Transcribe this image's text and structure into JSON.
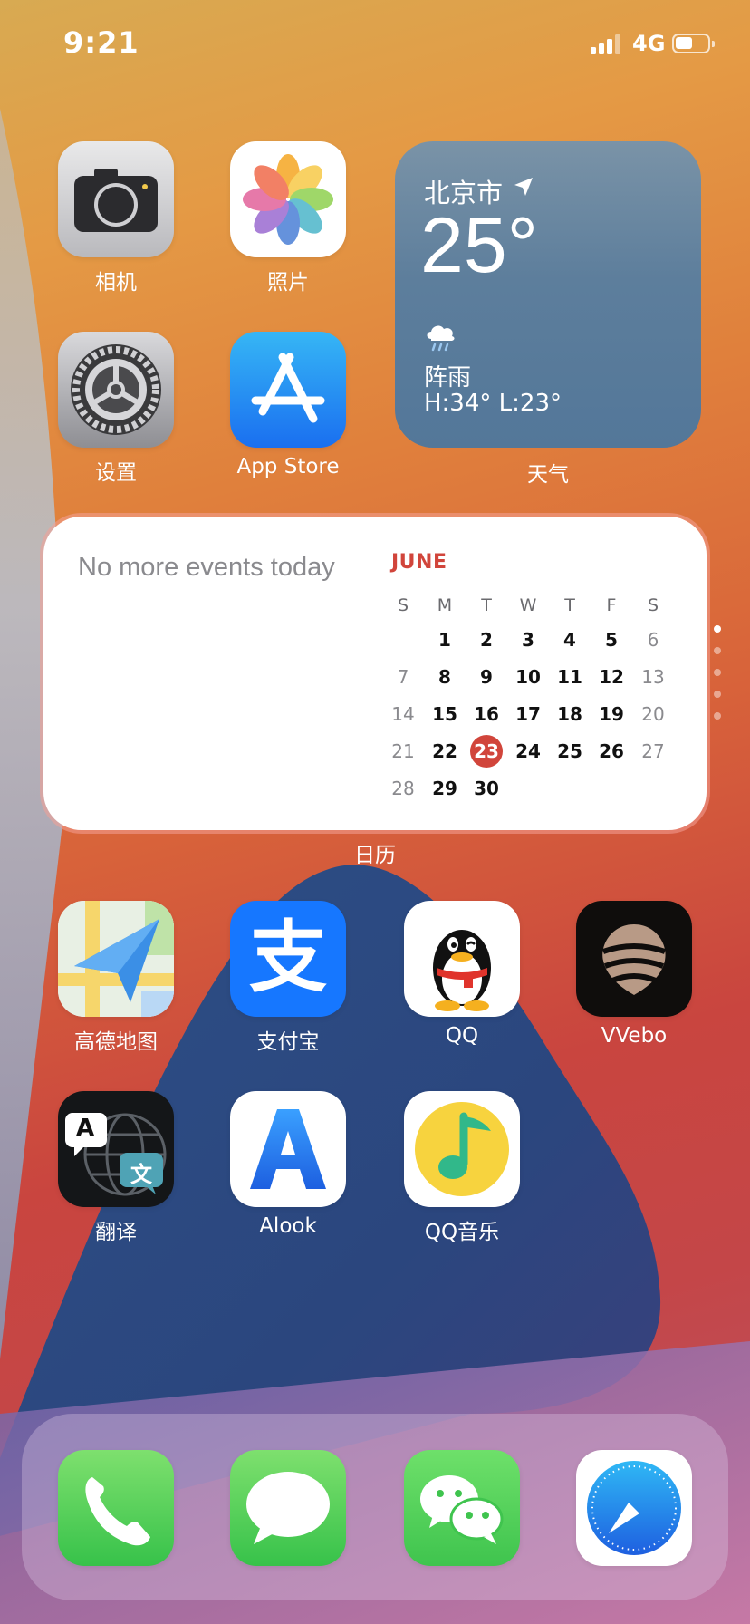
{
  "status": {
    "time": "9:21",
    "network": "4G",
    "battery_level": 0.45
  },
  "apps": {
    "camera": "相机",
    "photos": "照片",
    "settings": "设置",
    "appstore": "App Store",
    "amap": "高德地图",
    "alipay": "支付宝",
    "qq": "QQ",
    "vvebo": "VVebo",
    "translate": "翻译",
    "alook": "Alook",
    "qqmusic": "QQ音乐"
  },
  "weather": {
    "city": "北京市",
    "temperature": "25°",
    "condition": "阵雨",
    "high_low": "H:34° L:23°",
    "widget_label": "天气"
  },
  "calendar": {
    "no_events": "No more events today",
    "month": "JUNE",
    "weekdays": [
      "S",
      "M",
      "T",
      "W",
      "T",
      "F",
      "S"
    ],
    "weeks": [
      [
        "",
        "1",
        "2",
        "3",
        "4",
        "5",
        "6"
      ],
      [
        "7",
        "8",
        "9",
        "10",
        "11",
        "12",
        "13"
      ],
      [
        "14",
        "15",
        "16",
        "17",
        "18",
        "19",
        "20"
      ],
      [
        "21",
        "22",
        "23",
        "24",
        "25",
        "26",
        "27"
      ],
      [
        "28",
        "29",
        "30",
        "",
        "",
        "",
        ""
      ]
    ],
    "today": "23",
    "widget_label": "日历"
  },
  "icon_text": {
    "translate_a": "A",
    "translate_wen": "文",
    "appstore_symbol": "A"
  },
  "page_dots": {
    "count": 5,
    "active": 0
  },
  "dock": [
    "phone-icon",
    "messages-icon",
    "wechat-icon",
    "safari-icon"
  ]
}
